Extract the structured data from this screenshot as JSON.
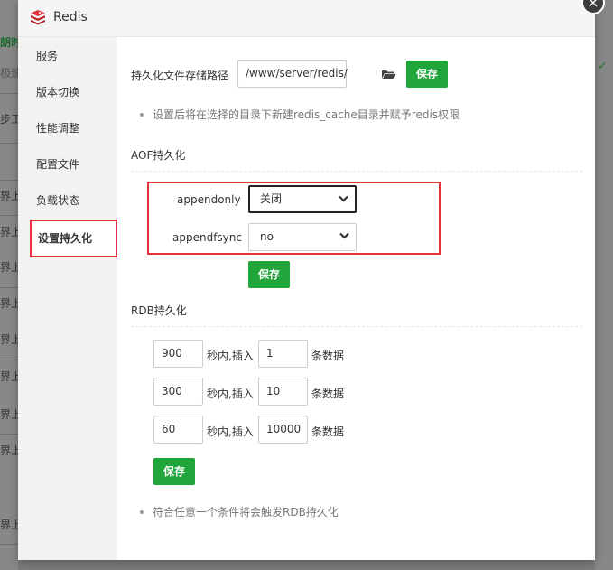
{
  "window": {
    "title": "Redis"
  },
  "background": {
    "fragments": [
      "朗时间",
      "极速",
      "步工",
      "界上",
      "界上",
      "界上",
      "界上",
      "界上",
      "界上",
      "界上",
      "界上",
      "界上"
    ]
  },
  "sidebar": {
    "items": [
      {
        "label": "服务"
      },
      {
        "label": "版本切换"
      },
      {
        "label": "性能调整"
      },
      {
        "label": "配置文件"
      },
      {
        "label": "负载状态"
      },
      {
        "label": "设置持久化"
      }
    ],
    "active_index": 5
  },
  "persist_path": {
    "label": "持久化文件存储路径",
    "value": "/www/server/redis/",
    "save_label": "保存",
    "tip": "设置后将在选择的目录下新建redis_cache目录并赋予redis权限"
  },
  "aof": {
    "title": "AOF持久化",
    "appendonly_label": "appendonly",
    "appendonly_value": "关闭",
    "appendfsync_label": "appendfsync",
    "appendfsync_value": "no",
    "save_label": "保存"
  },
  "rdb": {
    "title": "RDB持久化",
    "rows": [
      {
        "seconds": "900",
        "mid_label": "秒内,插入",
        "count": "1",
        "end_label": "条数据"
      },
      {
        "seconds": "300",
        "mid_label": "秒内,插入",
        "count": "10",
        "end_label": "条数据"
      },
      {
        "seconds": "60",
        "mid_label": "秒内,插入",
        "count": "10000",
        "end_label": "条数据"
      }
    ],
    "save_label": "保存",
    "tip": "符合任意一个条件将会触发RDB持久化"
  },
  "colors": {
    "accent_green": "#20a53a",
    "highlight_red": "#e5323a"
  }
}
